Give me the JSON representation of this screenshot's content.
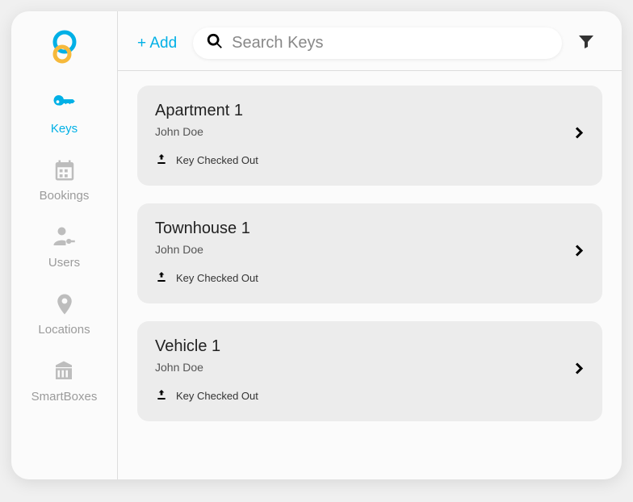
{
  "topbar": {
    "add_label": "+ Add",
    "search_placeholder": "Search Keys"
  },
  "sidebar": {
    "items": [
      {
        "id": "keys",
        "label": "Keys",
        "active": true
      },
      {
        "id": "bookings",
        "label": "Bookings",
        "active": false
      },
      {
        "id": "users",
        "label": "Users",
        "active": false
      },
      {
        "id": "locations",
        "label": "Locations",
        "active": false
      },
      {
        "id": "smartboxes",
        "label": "SmartBoxes",
        "active": false
      }
    ]
  },
  "keys_list": [
    {
      "title": "Apartment 1",
      "owner": "John Doe",
      "status": "Key Checked Out"
    },
    {
      "title": "Townhouse 1",
      "owner": "John Doe",
      "status": "Key Checked Out"
    },
    {
      "title": "Vehicle 1",
      "owner": "John Doe",
      "status": "Key Checked Out"
    }
  ]
}
